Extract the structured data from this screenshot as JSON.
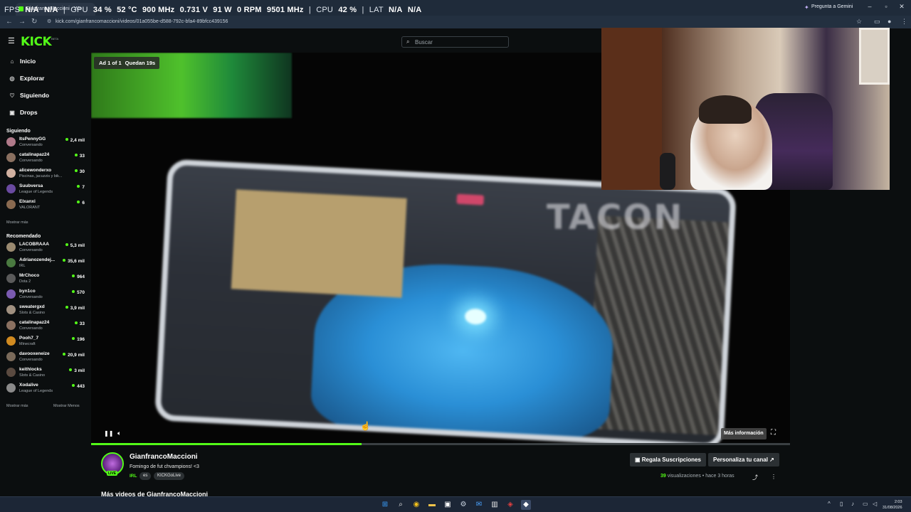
{
  "browser": {
    "osd": {
      "fps_label": "FPS",
      "fps_value": "N/A",
      "fps_value2": "N/A",
      "gpu_label": "GPU",
      "gpu_load": "34 %",
      "gpu_temp": "52 °C",
      "gpu_clock": "900 MHz",
      "gpu_voltage": "0.731 V",
      "gpu_power": "91 W",
      "gpu_fan": "0 RPM",
      "gpu_mem": "9501 MHz",
      "cpu_label": "CPU",
      "cpu_load": "42 %",
      "lat_label": "LAT",
      "lat_value": "N/A",
      "lat_value2": "N/A"
    },
    "tab_title": "GianfrancoMaccioni - Wa",
    "gemini_label": "Pregunta a Gemini",
    "url": "kick.com/gianfrancomaccioni/videos/01a055be-d588-792c-bfa4-89bfcc439156"
  },
  "kick": {
    "logo": "KICK",
    "logo_badge": "BETA",
    "search_placeholder": "Buscar"
  },
  "sidebar": {
    "nav": [
      {
        "label": "Inicio",
        "icon": "home-icon"
      },
      {
        "label": "Explorar",
        "icon": "compass-icon"
      },
      {
        "label": "Siguiendo",
        "icon": "heart-icon"
      },
      {
        "label": "Drops",
        "icon": "gift-icon"
      }
    ],
    "following_title": "Siguiendo",
    "following": [
      {
        "name": "ItsPennyGG",
        "sub": "Conversando",
        "viewers": "2,4 mil",
        "color": "#b07a8a"
      },
      {
        "name": "catalinapaz24",
        "sub": "Conversando",
        "viewers": "33",
        "color": "#8a7060"
      },
      {
        "name": "alicewonderxo",
        "sub": "Piscinas, jacuzzis y bik...",
        "viewers": "30",
        "color": "#d0b0a0"
      },
      {
        "name": "Suubversa",
        "sub": "League of Legends",
        "viewers": "7",
        "color": "#6a4aa0"
      },
      {
        "name": "Elxanxi",
        "sub": "VALORANT",
        "viewers": "6",
        "color": "#8a6a50"
      }
    ],
    "following_more": "Mostrar más",
    "recommended_title": "Recomendado",
    "recommended": [
      {
        "name": "LACOBRAAA",
        "sub": "Conversando",
        "viewers": "5,3 mil",
        "color": "#9a8a70"
      },
      {
        "name": "Adrianozendej...",
        "sub": "IRL",
        "viewers": "35,6 mil",
        "color": "#4a7a40"
      },
      {
        "name": "MrChoco",
        "sub": "Dota 2",
        "viewers": "964",
        "color": "#5a5a5a"
      },
      {
        "name": "byn1co",
        "sub": "Conversando",
        "viewers": "570",
        "color": "#7a5ab0"
      },
      {
        "name": "sweatergxd",
        "sub": "Slots & Casino",
        "viewers": "3,9 mil",
        "color": "#a09080"
      },
      {
        "name": "catalinapaz24",
        "sub": "Conversando",
        "viewers": "33",
        "color": "#8a7060"
      },
      {
        "name": "Pooh7_7",
        "sub": "Minecraft",
        "viewers": "196",
        "color": "#d08a20"
      },
      {
        "name": "davooxeneize",
        "sub": "Conversando",
        "viewers": "20,9 mil",
        "color": "#7a6a5a"
      },
      {
        "name": "keithlocks",
        "sub": "Slots & Casino",
        "viewers": "3 mil",
        "color": "#5a4a40"
      },
      {
        "name": "Xodalive",
        "sub": "League of Legends",
        "viewers": "443",
        "color": "#8a8a8a"
      }
    ],
    "show_more": "Mostrar más",
    "show_less": "Mostrar Menos"
  },
  "player": {
    "ad_label": "Ad 1 of 1",
    "ad_remaining": "Quedan 19s",
    "overlay_text": "TACON",
    "more_info": "Más información",
    "progress": 0.387
  },
  "channel": {
    "name": "GianfrancoMaccioni",
    "live_badge": "LIVE",
    "description": "Fomingo de fut chvampions! <3",
    "category": "IRL",
    "tags": [
      "es",
      "KICKGoLive"
    ],
    "gift_button": "Regala Suscripciones",
    "customize_button": "Personaliza tu canal",
    "views_count": "39",
    "views_label": "visualizaciones",
    "time_ago": "hace 3 horas",
    "more_videos": "Más videos de GianfrancoMaccioni"
  },
  "taskbar": {
    "time": "2:03",
    "date": "31/08/2026"
  },
  "colors": {
    "kick_green": "#53fc18",
    "background": "#0b0e0f",
    "chrome_bg": "#1f2b3a"
  }
}
